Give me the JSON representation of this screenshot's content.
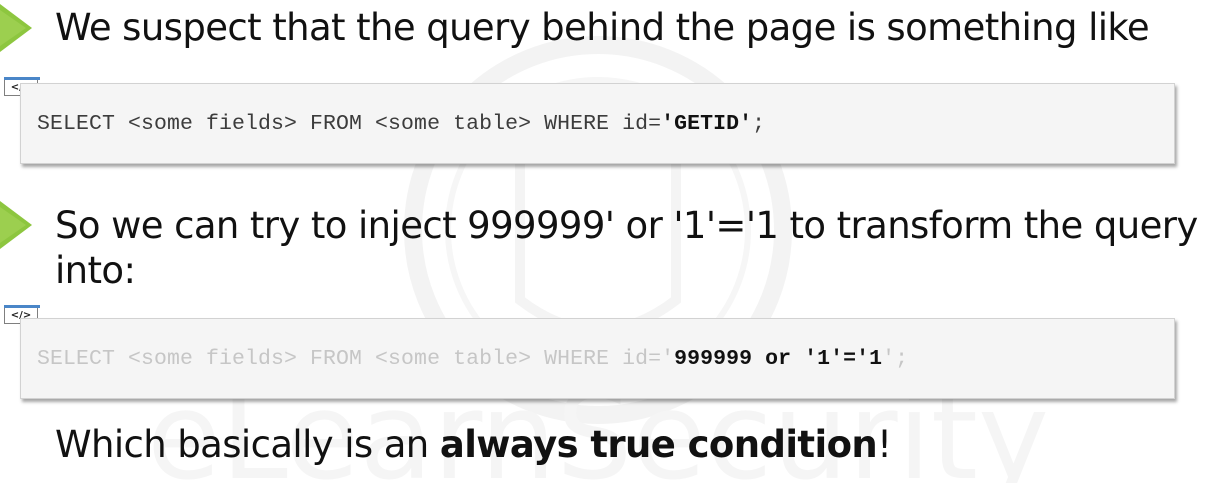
{
  "watermark": {
    "text": "eLearnSecurity"
  },
  "line1": {
    "text": "We suspect that the query behind the page is something like"
  },
  "code1": {
    "icon_label": "</>",
    "prefix": "SELECT <some fields> FROM <some table> WHERE id=",
    "highlight": "'GETID'",
    "suffix": ";"
  },
  "line2": {
    "text": "So we can try to inject 999999' or '1'='1 to transform the query into:"
  },
  "code2": {
    "icon_label": "</>",
    "prefix": "SELECT <some fields> FROM <some table> WHERE id='",
    "highlight": "999999 or '1'='1",
    "suffix": "';"
  },
  "line3": {
    "before": "Which basically is an ",
    "bold": "always true condition",
    "after": "!"
  },
  "colors": {
    "bullet_green": "#8dc63f",
    "icon_blue": "#4a86c8",
    "code_background": "#f5f5f5"
  }
}
